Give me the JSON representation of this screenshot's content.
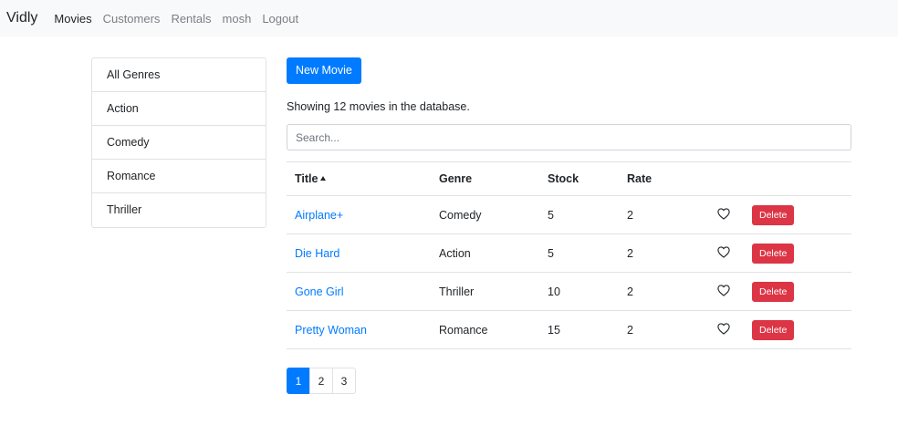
{
  "navbar": {
    "brand": "Vidly",
    "links": [
      "Movies",
      "Customers",
      "Rentals",
      "mosh",
      "Logout"
    ],
    "active_index": 0
  },
  "genres": {
    "items": [
      "All Genres",
      "Action",
      "Comedy",
      "Romance",
      "Thriller"
    ]
  },
  "main": {
    "new_button": "New Movie",
    "count_text": "Showing 12 movies in the database.",
    "search_placeholder": "Search..."
  },
  "table": {
    "headers": {
      "title": "Title",
      "genre": "Genre",
      "stock": "Stock",
      "rate": "Rate"
    },
    "sort_column": "title",
    "sort_direction": "asc",
    "rows": [
      {
        "title": "Airplane+",
        "genre": "Comedy",
        "stock": "5",
        "rate": "2",
        "liked": false,
        "delete": "Delete"
      },
      {
        "title": "Die Hard",
        "genre": "Action",
        "stock": "5",
        "rate": "2",
        "liked": false,
        "delete": "Delete"
      },
      {
        "title": "Gone Girl",
        "genre": "Thriller",
        "stock": "10",
        "rate": "2",
        "liked": false,
        "delete": "Delete"
      },
      {
        "title": "Pretty Woman",
        "genre": "Romance",
        "stock": "15",
        "rate": "2",
        "liked": false,
        "delete": "Delete"
      }
    ]
  },
  "pagination": {
    "pages": [
      "1",
      "2",
      "3"
    ],
    "current": "1"
  },
  "colors": {
    "primary": "#007bff",
    "danger": "#dc3545",
    "navbar_bg": "#f8f9fa"
  },
  "icons": {
    "like": "heart-outline-icon",
    "sort": "caret-up-icon"
  }
}
